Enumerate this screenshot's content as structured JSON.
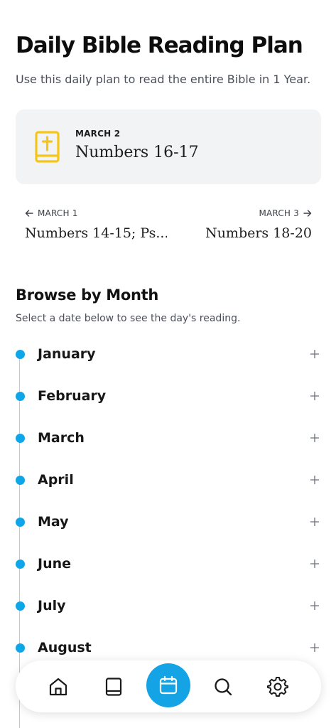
{
  "header": {
    "title": "Daily Bible Reading Plan",
    "subtitle": "Use this daily plan to read the entire Bible in 1 Year."
  },
  "today": {
    "date": "MARCH 2",
    "reference": "Numbers 16-17",
    "icon": "bible-icon",
    "icon_color": "#f5c518"
  },
  "previous": {
    "date": "MARCH 1",
    "reference": "Numbers 14-15; Ps...",
    "icon": "arrow-left-icon"
  },
  "next": {
    "date": "MARCH 3",
    "reference": "Numbers 18-20",
    "icon": "arrow-right-icon"
  },
  "browse": {
    "title": "Browse by Month",
    "subtitle": "Select a date below to see the day's reading.",
    "months": [
      "January",
      "February",
      "March",
      "April",
      "May",
      "June",
      "July",
      "August"
    ],
    "accent": "#0ea5e9"
  },
  "bottom_nav": {
    "items": [
      "home-icon",
      "book-icon",
      "calendar-icon",
      "search-icon",
      "settings-icon"
    ],
    "active": "calendar-icon",
    "active_color": "#14a4e6"
  }
}
